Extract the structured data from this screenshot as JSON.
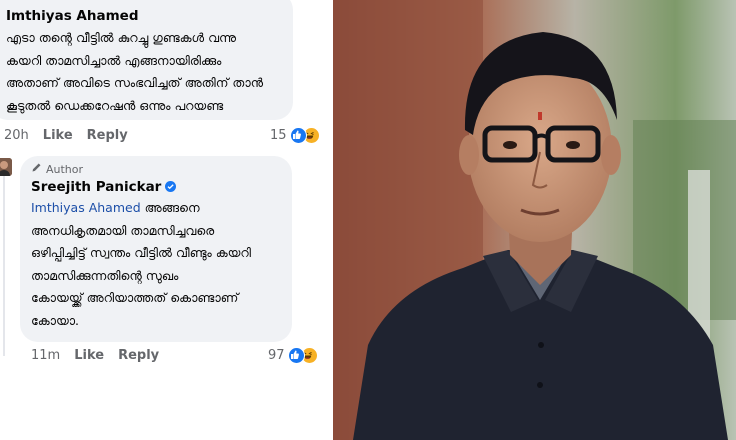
{
  "comment1": {
    "author": "Imthiyas Ahamed",
    "lines": [
      "എടാ തന്റെ വീട്ടിൽ കുറച്ചു ഗുണ്ടകൾ വന്നു",
      "കയറി താമസിച്ചാൽ എങ്ങനായിരിക്കും",
      "അതാണ് അവിടെ സംഭവിച്ചത് അതിന് താൻ",
      "കൂടുതൽ ഡെക്കറേഷൻ ഒന്നും പറയണ്ട"
    ],
    "time": "20h",
    "like_label": "Like",
    "reply_label": "Reply",
    "reaction_count": "15"
  },
  "comment2": {
    "badge": "Author",
    "author": "Sreejith Panickar",
    "mention": "Imthiyas Ahamed",
    "first_line_rest": " അങ്ങനെ",
    "lines": [
      "അനധികൃതമായി താമസിച്ചവരെ",
      "ഒഴിപ്പിച്ചിട്ട് സ്വന്തം വീട്ടിൽ വീണ്ടും കയറി",
      "താമസിക്കുന്നതിന്റെ സുഖം",
      "കോയയ്ക്ക് അറിയാത്തത് കൊണ്ടാണ്",
      "കോയാ."
    ],
    "time": "11m",
    "like_label": "Like",
    "reply_label": "Reply",
    "reaction_count": "97"
  },
  "colors": {
    "bubble_bg": "#f0f2f5",
    "meta_text": "#65676b",
    "mention": "#1d4fa8",
    "like_blue": "#1877f2",
    "haha_yellow": "#f7b125"
  },
  "icons": [
    "like-reaction-icon",
    "haha-reaction-icon",
    "author-pen-icon",
    "verified-badge-icon"
  ]
}
